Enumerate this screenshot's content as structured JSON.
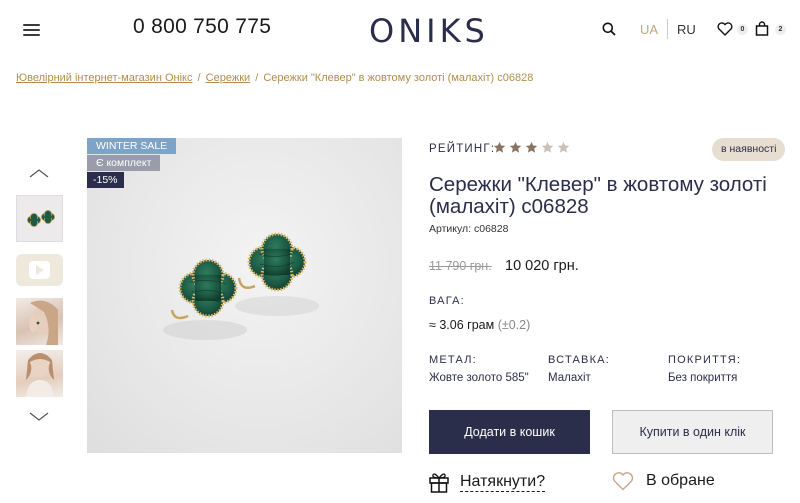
{
  "header": {
    "phone": "0 800 750 775",
    "logo": "ONIKS",
    "lang_ua": "UA",
    "lang_ru": "RU",
    "wishlist_count": "0",
    "cart_count": "2"
  },
  "breadcrumb": {
    "items": [
      "Ювелірний інтернет-магазин Онікс",
      "Сережки",
      "Сережки \"Клевер\" в жовтому золоті (малахіт) с06828"
    ],
    "separator": "/"
  },
  "gallery": {
    "tags": [
      "WINTER SALE",
      "Є комплект",
      "-15%"
    ]
  },
  "product": {
    "rating_label": "РЕЙТИНГ:",
    "rating": 3,
    "rating_max": 5,
    "stock": "в наявності",
    "title": "Сережки \"Клевер\" в жовтому золоті (малахіт) с06828",
    "sku": "Артикул: с06828",
    "old_price": "11 790 грн.",
    "new_price": "10 020 грн.",
    "weight_label": "ВАГА:",
    "weight_value": "≈ 3.06 грам",
    "weight_tolerance": "(±0.2)",
    "metal_label": "МЕТАЛ:",
    "metal_value": "Жовте золото 585\"",
    "insert_label": "ВСТАВКА:",
    "insert_value": "Малахіт",
    "coating_label": "ПОКРИТТЯ:",
    "coating_value": "Без покриття"
  },
  "actions": {
    "add_to_cart": "Додати в кошик",
    "buy_one_click": "Купити в один клік",
    "hint": "Натякнути?",
    "favorite": "В обране"
  },
  "colors": {
    "primary": "#2b2e4a",
    "gold": "#b08d4c",
    "star_filled": "#8a7560",
    "star_empty": "#c9c1b8",
    "malachite": "#1f5a45"
  }
}
